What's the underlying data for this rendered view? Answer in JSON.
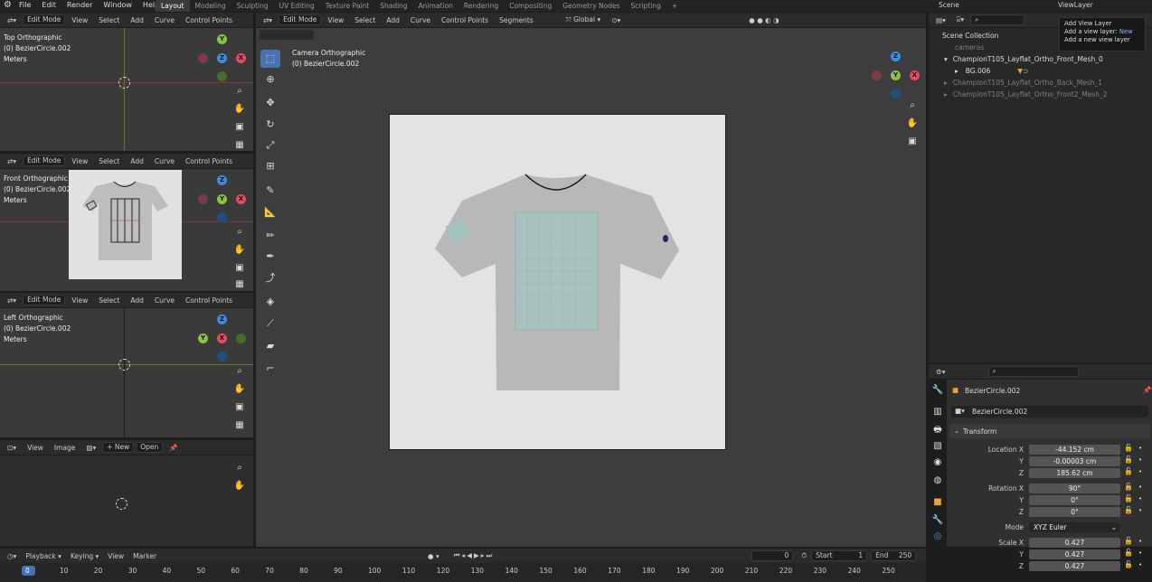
{
  "menu": [
    "File",
    "Edit",
    "Render",
    "Window",
    "Help"
  ],
  "workspaces": [
    "Layout",
    "Modeling",
    "Sculpting",
    "UV Editing",
    "Texture Paint",
    "Shading",
    "Animation",
    "Rendering",
    "Compositing",
    "Geometry Nodes",
    "Scripting"
  ],
  "active_workspace": "Layout",
  "scene": "Scene",
  "view_layer": "ViewLayer",
  "tooltip": {
    "title": "Add View Layer",
    "line1_label": "Add a view layer:",
    "line1_value": "New",
    "line2": "Add a new view layer"
  },
  "viewport_header": {
    "mode": "Edit Mode",
    "items": [
      "View",
      "Select",
      "Add",
      "Curve",
      "Control Points"
    ],
    "segments": "Segments",
    "orientation": "Global"
  },
  "top_view": {
    "name": "Top Orthographic",
    "object": "(0) BezierCircle.002",
    "units": "Meters"
  },
  "front_view": {
    "name": "Front Orthographic",
    "object": "(0) BezierCircle.002",
    "units": "Meters"
  },
  "left_view": {
    "name": "Left Orthographic",
    "object": "(0) BezierCircle.002",
    "units": "Meters"
  },
  "camera_view": {
    "name": "Camera Orthographic",
    "object": "(0) BezierCircle.002"
  },
  "image_editor": {
    "items": [
      "View",
      "Image"
    ],
    "new": "New",
    "open": "Open"
  },
  "outliner": {
    "title": "Scene Collection",
    "rows": [
      {
        "label": "cameras",
        "dim": true
      },
      {
        "label": "ChampionT105_Layflat_Ortho_Front_Mesh_0",
        "dim": false
      },
      {
        "label": "BG.006",
        "dim": false
      },
      {
        "label": "ChampionT105_Layflat_Ortho_Back_Mesh_1",
        "dim": true
      },
      {
        "label": "ChampionT105_Layflat_Ortho_Front2_Mesh_2",
        "dim": true
      }
    ]
  },
  "properties": {
    "object": "BezierCircle.002",
    "data": "BezierCircle.002",
    "panel": "Transform",
    "location": {
      "label": "Location X",
      "x": "-44.152 cm",
      "y": "-0.00003 cm",
      "z": "185.62 cm"
    },
    "rotation": {
      "label": "Rotation X",
      "x": "90°",
      "y": "0°",
      "z": "0°"
    },
    "mode": {
      "label": "Mode",
      "value": "XYZ Euler"
    },
    "scale": {
      "label": "Scale X",
      "x": "0.427",
      "y": "0.427",
      "z": "0.427"
    },
    "axis_y": "Y",
    "axis_z": "Z"
  },
  "timeline": {
    "items": [
      "Playback",
      "Keying",
      "View",
      "Marker"
    ],
    "current": "0",
    "start_label": "Start",
    "start": "1",
    "end_label": "End",
    "end": "250",
    "ticks": [
      "0",
      "10",
      "20",
      "30",
      "40",
      "50",
      "60",
      "70",
      "80",
      "90",
      "100",
      "110",
      "120",
      "130",
      "140",
      "150",
      "160",
      "170",
      "180",
      "190",
      "200",
      "210",
      "220",
      "230",
      "240",
      "250"
    ]
  },
  "axes": {
    "x": "X",
    "y": "Y",
    "z": "Z"
  },
  "colors": {
    "x": "#e84a5f",
    "y": "#8bc53f",
    "z": "#3b8fe0",
    "accent": "#4772b3"
  }
}
